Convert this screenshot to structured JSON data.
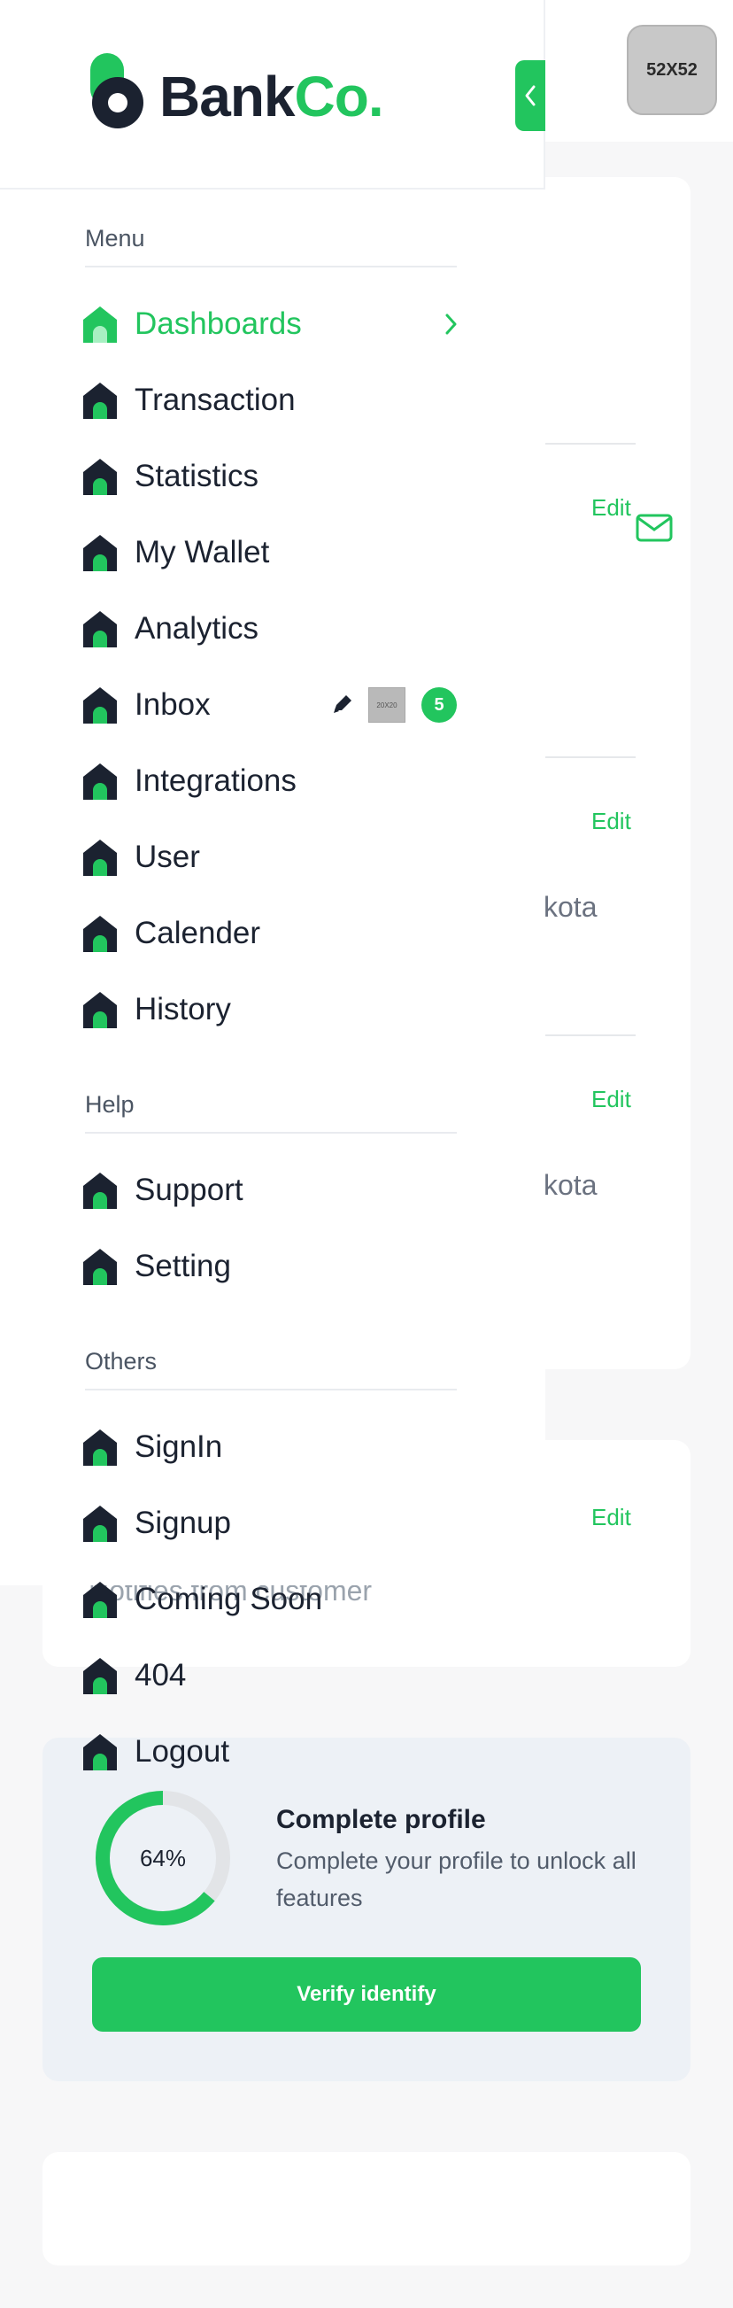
{
  "header": {
    "avatar_placeholder": "52X52"
  },
  "brand": {
    "name_part1": "Bank",
    "name_part2": "Co.",
    "accent": "#22c55e",
    "dark": "#1b2230"
  },
  "sidebar": {
    "sections": [
      {
        "title": "Menu"
      },
      {
        "title": "Help"
      },
      {
        "title": "Others"
      }
    ],
    "menu": [
      {
        "label": "Dashboards",
        "active": true
      },
      {
        "label": "Transaction"
      },
      {
        "label": "Statistics"
      },
      {
        "label": "My Wallet"
      },
      {
        "label": "Analytics"
      },
      {
        "label": "Inbox",
        "badge": "5",
        "thumb": "20X20"
      },
      {
        "label": "Integrations"
      },
      {
        "label": "User"
      },
      {
        "label": "Calender"
      },
      {
        "label": "History"
      }
    ],
    "help": [
      {
        "label": "Support"
      },
      {
        "label": "Setting"
      }
    ],
    "others": [
      {
        "label": "SignIn"
      },
      {
        "label": "Signup"
      },
      {
        "label": "Coming Soon"
      },
      {
        "label": "404"
      },
      {
        "label": "Logout"
      }
    ]
  },
  "content": {
    "edit_label": "Edit",
    "partial_text": "kota",
    "ghost_text": "Notifies from customer"
  },
  "profile": {
    "progress_percent": 64,
    "progress_label": "64%",
    "title": "Complete profile",
    "subtitle": "Complete your profile to unlock all features",
    "button": "Verify identify"
  }
}
